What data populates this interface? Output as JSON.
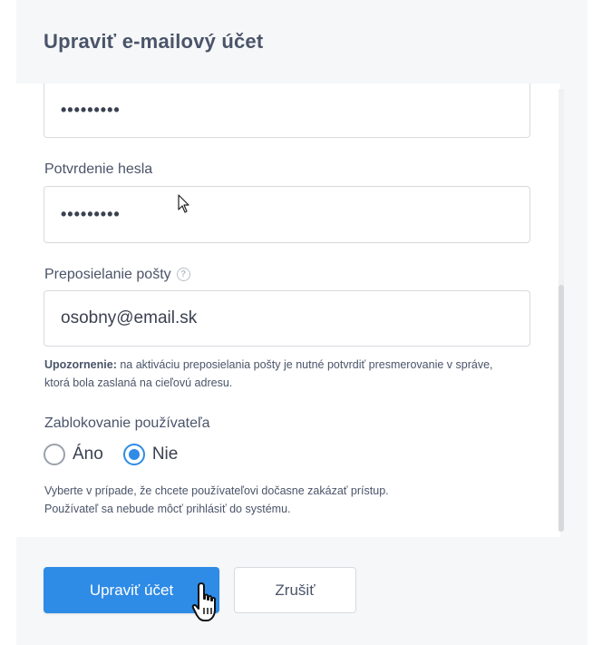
{
  "dialog": {
    "title": "Upraviť e-mailový účet"
  },
  "password": {
    "value": "•••••••••"
  },
  "password_confirm": {
    "label": "Potvrdenie hesla",
    "value": "•••••••••"
  },
  "forwarding": {
    "label": "Preposielanie pošty",
    "help_icon": "question-circle-icon",
    "help_glyph": "?",
    "value": "osobny@email.sk",
    "warning_bold": "Upozornenie:",
    "warning_text": " na aktiváciu preposielania pošty je nutné potvrdiť presmerovanie v správe, ktorá bola zaslaná na cieľovú adresu."
  },
  "block_user": {
    "label": "Zablokovanie používateľa",
    "options": [
      {
        "label": "Áno",
        "selected": false
      },
      {
        "label": "Nie",
        "selected": true
      }
    ],
    "note_line1": "Vyberte v prípade, že chcete používateľovi dočasne zakázať prístup.",
    "note_line2": "Používateľ sa nebude môcť prihlásiť do systému."
  },
  "actions": {
    "submit_label": "Upraviť účet",
    "cancel_label": "Zrušiť"
  },
  "colors": {
    "accent": "#2e8be6",
    "text": "#4a5469",
    "border": "#d7dade"
  }
}
